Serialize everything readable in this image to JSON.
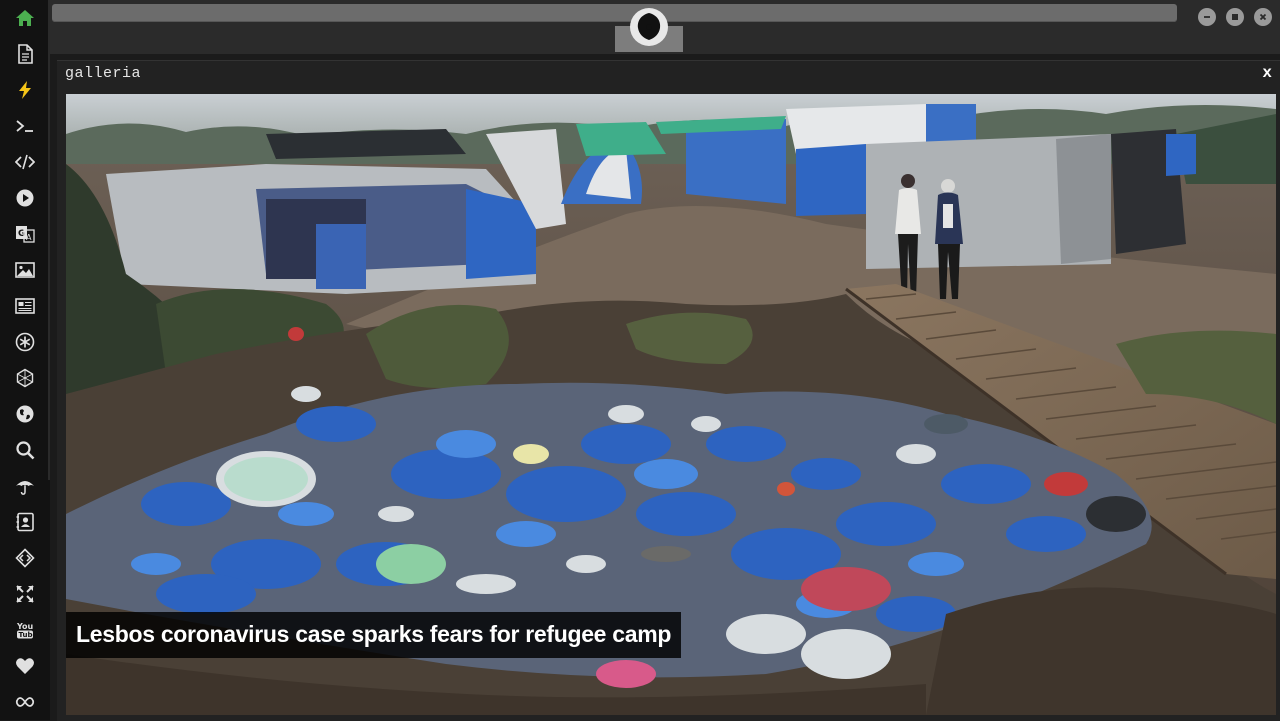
{
  "sidebar": {
    "items": [
      {
        "name": "home-icon",
        "color": "#4caf50"
      },
      {
        "name": "document-icon",
        "color": "#e0e0e0"
      },
      {
        "name": "lightning-icon",
        "color": "#f5c518"
      },
      {
        "name": "terminal-icon",
        "color": "#e0e0e0"
      },
      {
        "name": "code-icon",
        "color": "#e0e0e0"
      },
      {
        "name": "play-icon",
        "color": "#e0e0e0"
      },
      {
        "name": "translate-icon",
        "color": "#e0e0e0"
      },
      {
        "name": "image-icon",
        "color": "#e0e0e0"
      },
      {
        "name": "news-icon",
        "color": "#e0e0e0"
      },
      {
        "name": "asterisk-icon",
        "color": "#e0e0e0"
      },
      {
        "name": "network-icon",
        "color": "#e0e0e0"
      },
      {
        "name": "globe-icon",
        "color": "#e0e0e0"
      },
      {
        "name": "search-icon",
        "color": "#e0e0e0"
      },
      {
        "name": "umbrella-icon",
        "color": "#e0e0e0"
      },
      {
        "name": "contact-icon",
        "color": "#e0e0e0"
      },
      {
        "name": "embed-code-icon",
        "color": "#e0e0e0"
      },
      {
        "name": "expand-icon",
        "color": "#e0e0e0"
      },
      {
        "name": "youtube-icon",
        "color": "#e0e0e0"
      },
      {
        "name": "heart-icon",
        "color": "#e0e0e0"
      },
      {
        "name": "infinity-icon",
        "color": "#e0e0e0"
      }
    ]
  },
  "topbar": {
    "logo_icon": "rebel-alliance-icon",
    "window_buttons": [
      "minimize-icon",
      "maximize-icon",
      "close-icon"
    ]
  },
  "panel": {
    "title": "galleria",
    "close_label": "x",
    "photo": {
      "description_icon": "refugee-camp-photo",
      "caption": "Lesbos coronavirus case sparks fears for refugee camp"
    }
  },
  "colors": {
    "background": "#1b1b1b",
    "sidebar": "#121212",
    "accent_green": "#4caf50",
    "accent_yellow": "#f5c518"
  }
}
